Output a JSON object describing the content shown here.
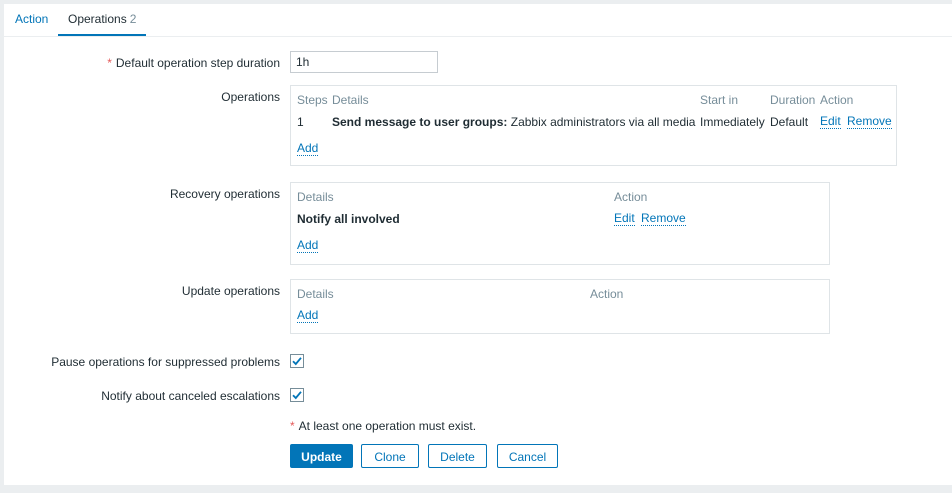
{
  "tabs": {
    "action_label": "Action",
    "operations_label": "Operations",
    "operations_count": "2"
  },
  "form": {
    "step_duration_label": "Default operation step duration",
    "step_duration_value": "1h",
    "operations_label": "Operations",
    "recovery_label": "Recovery operations",
    "update_label": "Update operations",
    "pause_label": "Pause operations for suppressed problems",
    "pause_checked": true,
    "notify_label": "Notify about canceled escalations",
    "notify_checked": true,
    "required_mark": "*"
  },
  "operations": {
    "headers": {
      "steps": "Steps",
      "details": "Details",
      "start_in": "Start in",
      "duration": "Duration",
      "action": "Action"
    },
    "rows": [
      {
        "step": "1",
        "details_bold": "Send message to user groups:",
        "details_rest": "Zabbix administrators via all media",
        "start_in": "Immediately",
        "duration": "Default",
        "edit": "Edit",
        "remove": "Remove"
      }
    ],
    "add": "Add"
  },
  "recovery": {
    "headers": {
      "details": "Details",
      "action": "Action"
    },
    "rows": [
      {
        "details": "Notify all involved",
        "edit": "Edit",
        "remove": "Remove"
      }
    ],
    "add": "Add"
  },
  "update": {
    "headers": {
      "details": "Details",
      "action": "Action"
    },
    "add": "Add"
  },
  "note": "At least one operation must exist.",
  "buttons": {
    "update": "Update",
    "clone": "Clone",
    "delete": "Delete",
    "cancel": "Cancel"
  }
}
